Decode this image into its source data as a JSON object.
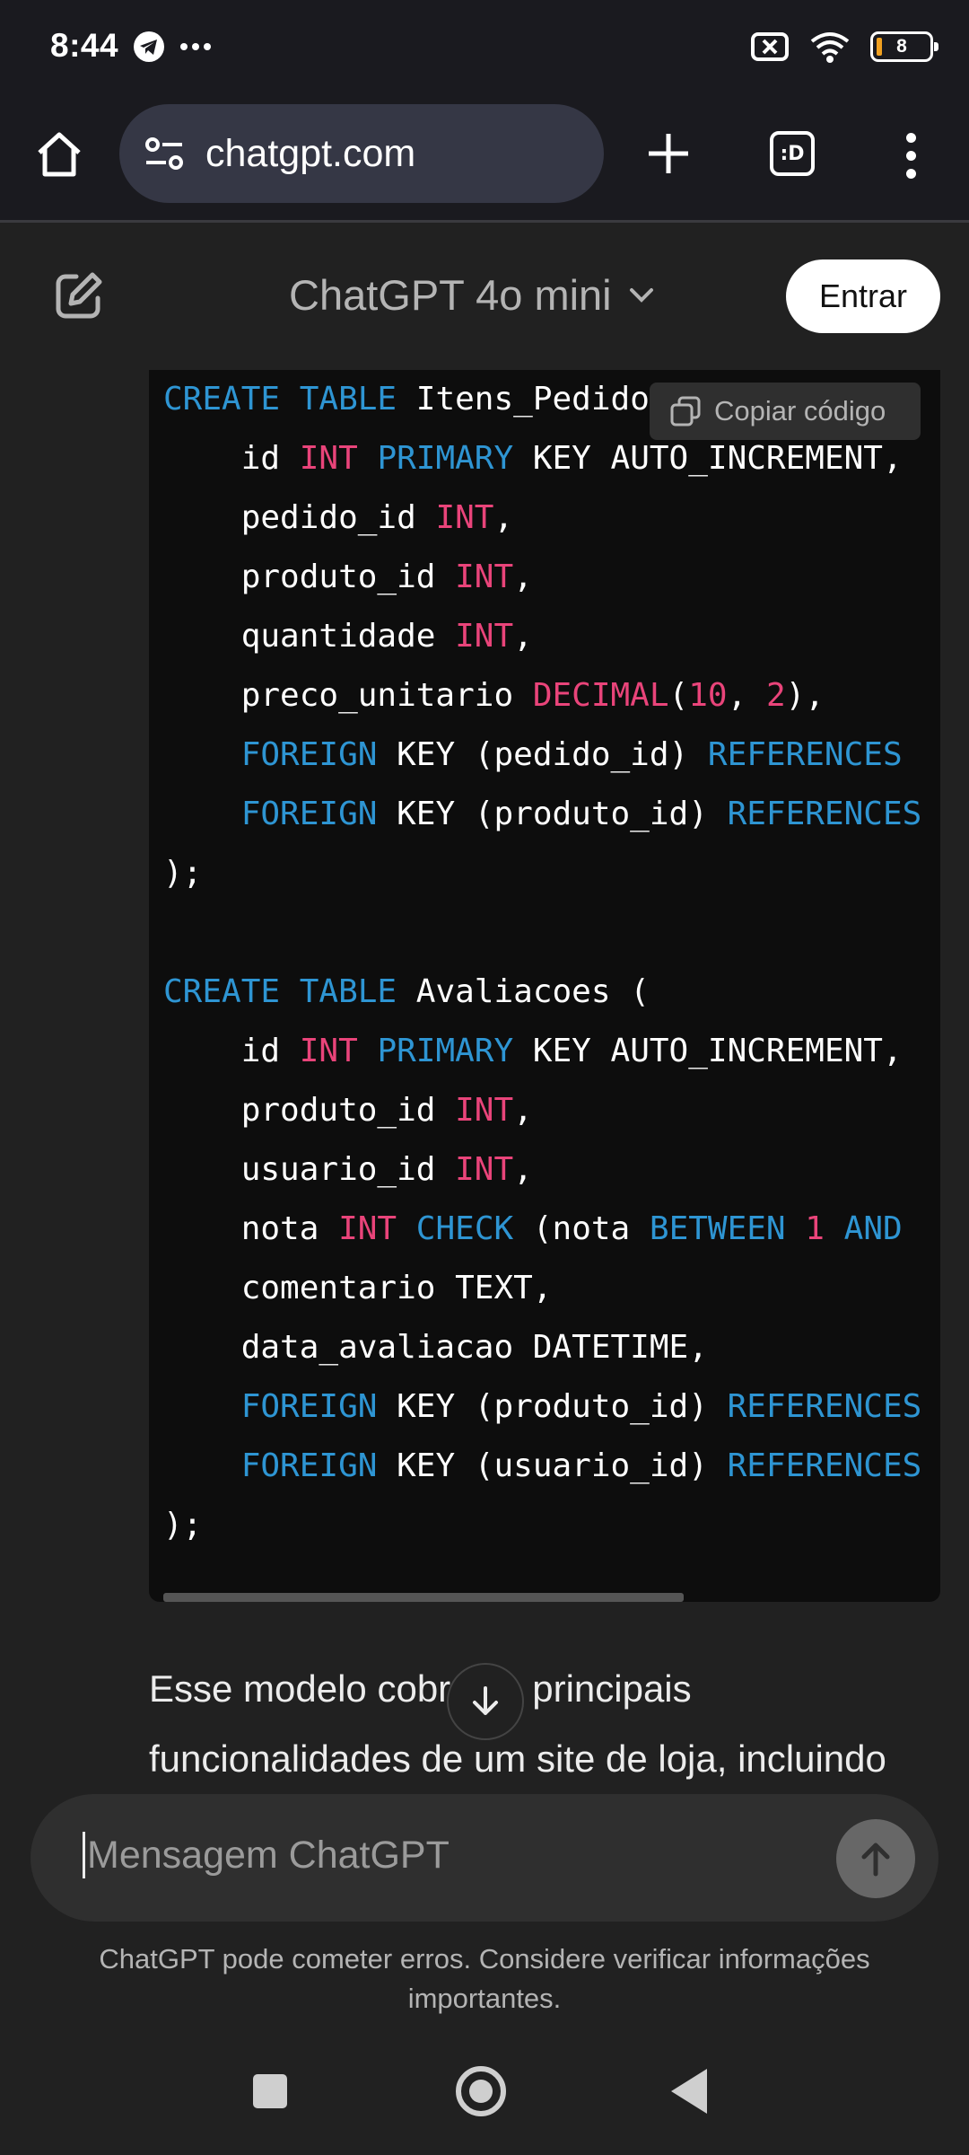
{
  "status_bar": {
    "time": "8:44",
    "battery_level": "8",
    "icons": [
      "telegram-icon",
      "more-dots-icon",
      "no-sim-icon",
      "wifi-icon",
      "battery-icon"
    ]
  },
  "browser": {
    "url": "chatgpt.com",
    "tabs_label": ":D"
  },
  "header": {
    "model_name": "ChatGPT 4o mini",
    "login_label": "Entrar"
  },
  "code_block": {
    "copy_label": "Copiar código",
    "lines": [
      [
        [
          "kw",
          "CREATE"
        ],
        [
          "p",
          " "
        ],
        [
          "kw",
          "TABLE"
        ],
        [
          "p",
          " Itens_Pedidos ("
        ]
      ],
      [
        [
          "p",
          "    id "
        ],
        [
          "ty",
          "INT"
        ],
        [
          "p",
          " "
        ],
        [
          "kw",
          "PRIMARY"
        ],
        [
          "p",
          " KEY AUTO_INCREMENT,"
        ]
      ],
      [
        [
          "p",
          "    pedido_id "
        ],
        [
          "ty",
          "INT"
        ],
        [
          "p",
          ","
        ]
      ],
      [
        [
          "p",
          "    produto_id "
        ],
        [
          "ty",
          "INT"
        ],
        [
          "p",
          ","
        ]
      ],
      [
        [
          "p",
          "    quantidade "
        ],
        [
          "ty",
          "INT"
        ],
        [
          "p",
          ","
        ]
      ],
      [
        [
          "p",
          "    preco_unitario "
        ],
        [
          "ty",
          "DECIMAL"
        ],
        [
          "p",
          "("
        ],
        [
          "num",
          "10"
        ],
        [
          "p",
          ", "
        ],
        [
          "num",
          "2"
        ],
        [
          "p",
          "),"
        ]
      ],
      [
        [
          "p",
          "    "
        ],
        [
          "kw",
          "FOREIGN"
        ],
        [
          "p",
          " KEY (pedido_id) "
        ],
        [
          "kw",
          "REFERENCES"
        ]
      ],
      [
        [
          "p",
          "    "
        ],
        [
          "kw",
          "FOREIGN"
        ],
        [
          "p",
          " KEY (produto_id) "
        ],
        [
          "kw",
          "REFERENCES"
        ]
      ],
      [
        [
          "p",
          ");"
        ]
      ],
      [
        [
          "p",
          ""
        ]
      ],
      [
        [
          "kw",
          "CREATE"
        ],
        [
          "p",
          " "
        ],
        [
          "kw",
          "TABLE"
        ],
        [
          "p",
          " Avaliacoes ("
        ]
      ],
      [
        [
          "p",
          "    id "
        ],
        [
          "ty",
          "INT"
        ],
        [
          "p",
          " "
        ],
        [
          "kw",
          "PRIMARY"
        ],
        [
          "p",
          " KEY AUTO_INCREMENT,"
        ]
      ],
      [
        [
          "p",
          "    produto_id "
        ],
        [
          "ty",
          "INT"
        ],
        [
          "p",
          ","
        ]
      ],
      [
        [
          "p",
          "    usuario_id "
        ],
        [
          "ty",
          "INT"
        ],
        [
          "p",
          ","
        ]
      ],
      [
        [
          "p",
          "    nota "
        ],
        [
          "ty",
          "INT"
        ],
        [
          "p",
          " "
        ],
        [
          "kw",
          "CHECK"
        ],
        [
          "p",
          " (nota "
        ],
        [
          "kw",
          "BETWEEN"
        ],
        [
          "p",
          " "
        ],
        [
          "num",
          "1"
        ],
        [
          "p",
          " "
        ],
        [
          "kw",
          "AND"
        ]
      ],
      [
        [
          "p",
          "    comentario TEXT,"
        ]
      ],
      [
        [
          "p",
          "    data_avaliacao DATETIME,"
        ]
      ],
      [
        [
          "p",
          "    "
        ],
        [
          "kw",
          "FOREIGN"
        ],
        [
          "p",
          " KEY (produto_id) "
        ],
        [
          "kw",
          "REFERENCES"
        ]
      ],
      [
        [
          "p",
          "    "
        ],
        [
          "kw",
          "FOREIGN"
        ],
        [
          "p",
          " KEY (usuario_id) "
        ],
        [
          "kw",
          "REFERENCES"
        ]
      ],
      [
        [
          "p",
          ");"
        ]
      ]
    ]
  },
  "response": {
    "text": "Esse modelo cobre os principais funcionalidades de um site de loja, incluindo"
  },
  "composer": {
    "placeholder": "Mensagem ChatGPT"
  },
  "disclaimer": "ChatGPT pode cometer erros. Considere verificar informações importantes."
}
